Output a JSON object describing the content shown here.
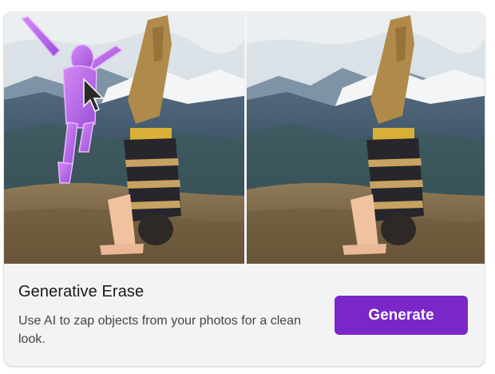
{
  "card": {
    "title": "Generative Erase",
    "description": "Use AI to zap objects from your photos for a clean look.",
    "generate_label": "Generate"
  },
  "images": {
    "before": "handstand-photo-with-highlighted-person",
    "after": "handstand-photo-with-person-removed"
  },
  "colors": {
    "accent": "#7b26c9",
    "highlight": "#c070f0",
    "card_background": "#f3f3f5"
  },
  "icons": {
    "cursor": "mouse-pointer-icon"
  }
}
